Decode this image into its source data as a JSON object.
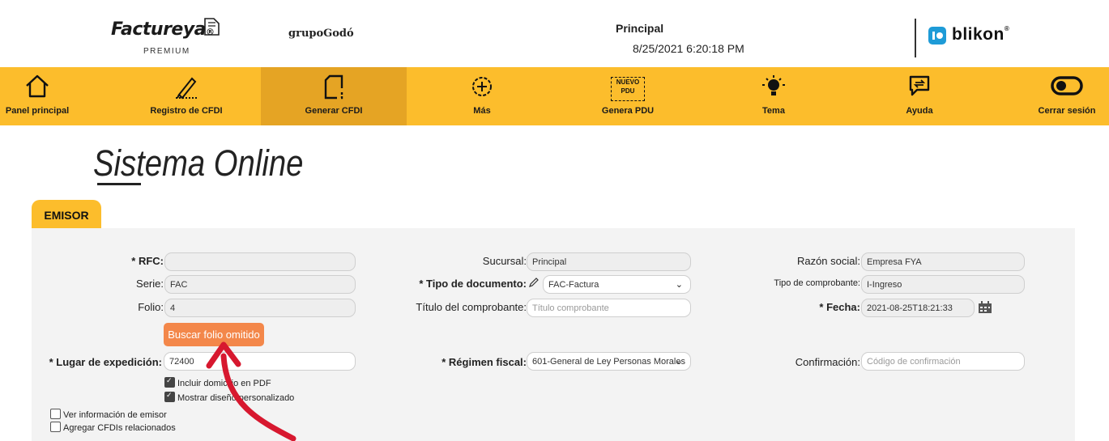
{
  "header": {
    "brand": "Factureya",
    "brand_mark": "®",
    "brand_sub": "PREMIUM",
    "partner": "grupoGodó",
    "branch": "Principal",
    "datetime": "8/25/2021 6:20:18 PM",
    "provider": "blikon",
    "provider_mark": "®"
  },
  "nav": {
    "items": [
      {
        "label": "Panel principal",
        "icon": "home-icon"
      },
      {
        "label": "Registro de CFDI",
        "icon": "pencil-icon"
      },
      {
        "label": "Generar CFDI",
        "icon": "document-icon",
        "active": true
      },
      {
        "label": "Más",
        "icon": "plus-circle-icon"
      },
      {
        "label": "Genera PDU",
        "icon": "new-pdu-icon",
        "badge_top": "NUEVO",
        "badge_bottom": "PDU"
      },
      {
        "label": "Tema",
        "icon": "lightbulb-icon"
      },
      {
        "label": "Ayuda",
        "icon": "chat-help-icon"
      },
      {
        "label": "Cerrar sesión",
        "icon": "toggle-icon"
      }
    ]
  },
  "page": {
    "title": "Sistema Online",
    "tab": "EMISOR"
  },
  "form": {
    "rfc": {
      "label": "* RFC:",
      "value": ""
    },
    "serie": {
      "label": "Serie:",
      "value": "FAC"
    },
    "folio": {
      "label": "Folio:",
      "value": "4"
    },
    "buscar_folio": "Buscar folio omitido",
    "lugar": {
      "label": "* Lugar de expedición:",
      "value": "72400"
    },
    "incluir_domicilio": "Incluir domicilio en PDF",
    "mostrar_diseno": "Mostrar diseño personalizado",
    "ver_info": "Ver información de emisor",
    "agregar_cfdis": "Agregar CFDIs relacionados",
    "sucursal": {
      "label": "Sucursal:",
      "value": "Principal"
    },
    "tipo_documento": {
      "label": "* Tipo de documento:",
      "value": "FAC-Factura"
    },
    "titulo": {
      "label": "Título del comprobante:",
      "placeholder": "Título comprobante"
    },
    "regimen": {
      "label": "* Régimen fiscal:",
      "value": "601-General de Ley Personas Morales"
    },
    "razon_social": {
      "label": "Razón social:",
      "value": "Empresa FYA"
    },
    "tipo_comprobante": {
      "label": "Tipo de comprobante:",
      "value": "I-Ingreso"
    },
    "fecha": {
      "label": "* Fecha:",
      "value": "2021-08-25T18:21:33"
    },
    "confirmacion": {
      "label": "Confirmación:",
      "placeholder": "Código de confirmación"
    }
  },
  "colors": {
    "nav_bg": "#fcbd2c",
    "nav_active": "#e5a424",
    "button_orange": "#f3874a",
    "arrow_red": "#d7182f",
    "blikon_blue": "#1e9bd7"
  }
}
